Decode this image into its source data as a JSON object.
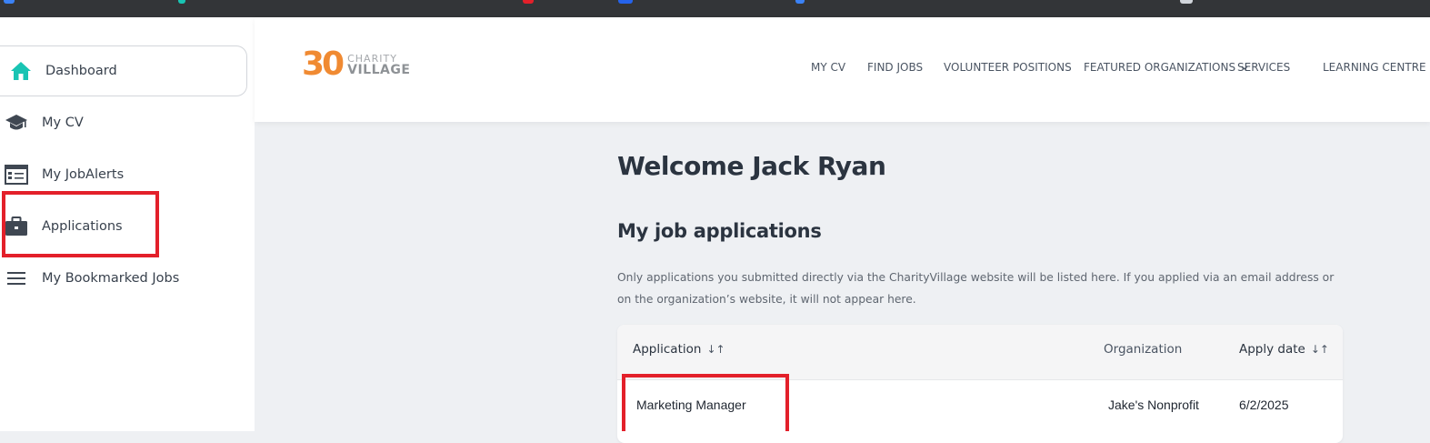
{
  "sidebar": {
    "items": [
      {
        "label": "Dashboard",
        "icon": "home-icon",
        "color": "#19c4b3"
      },
      {
        "label": "My CV",
        "icon": "graduation-cap-icon",
        "color": "#3f4752"
      },
      {
        "label": "My JobAlerts",
        "icon": "job-alerts-icon",
        "color": "#3f4752"
      },
      {
        "label": "Applications",
        "icon": "briefcase-icon",
        "color": "#3f4752"
      },
      {
        "label": "My Bookmarked Jobs",
        "icon": "menu-lines-icon",
        "color": "#3f4752"
      }
    ]
  },
  "header": {
    "logo": {
      "number": "30",
      "word1": "CHARITY",
      "word2": "VILLAGE"
    },
    "nav": [
      "MY CV",
      "FIND JOBS",
      "VOLUNTEER POSITIONS",
      "FEATURED ORGANIZATIONS",
      "SERVICES",
      "LEARNING CENTRE"
    ]
  },
  "main": {
    "welcome": "Welcome Jack Ryan",
    "section_title": "My job applications",
    "note": "Only applications you submitted directly via the CharityVillage website will be listed here. If you applied via an email address or on the organization’s website, it will not appear here.",
    "table": {
      "columns": [
        "Application",
        "Organization",
        "Apply date"
      ],
      "rows": [
        {
          "application": "Marketing Manager",
          "organization": "Jake's Nonprofit",
          "apply_date": "6/2/2025"
        }
      ]
    }
  },
  "colors": {
    "accent": "#19c4b3",
    "brand_orange": "#f08a32",
    "highlight": "#e3202a"
  }
}
